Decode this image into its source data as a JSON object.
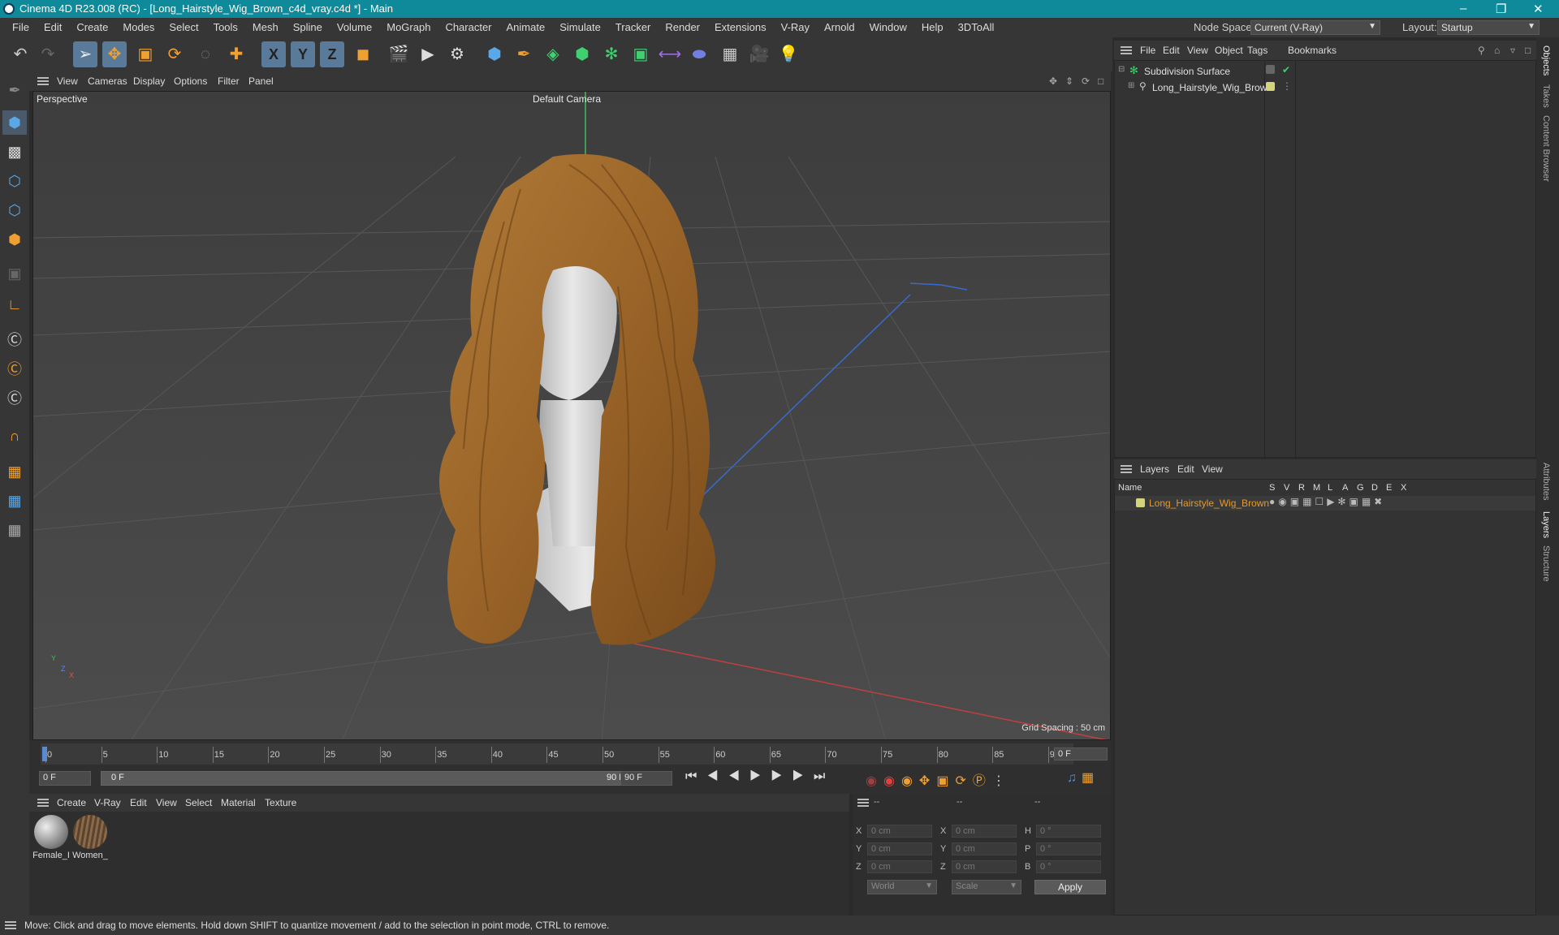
{
  "window": {
    "title": "Cinema 4D R23.008 (RC) - [Long_Hairstyle_Wig_Brown_c4d_vray.c4d *] - Main",
    "controls": [
      "–",
      "❐",
      "✕"
    ]
  },
  "menubar": {
    "items": [
      "File",
      "Edit",
      "Create",
      "Modes",
      "Select",
      "Tools",
      "Mesh",
      "Spline",
      "Volume",
      "MoGraph",
      "Character",
      "Animate",
      "Simulate",
      "Tracker",
      "Render",
      "Extensions",
      "V-Ray",
      "Arnold",
      "Window",
      "Help",
      "3DToAll"
    ],
    "node_space_label": "Node Space:",
    "node_space_value": "Current (V-Ray)",
    "layout_label": "Layout:",
    "layout_value": "Startup"
  },
  "toolbar": {
    "icons": [
      "undo-icon",
      "redo-icon",
      "select-icon",
      "move-icon",
      "scale-icon",
      "rotate-icon",
      "recent-tool-icon",
      "add-icon",
      "x-axis-icon",
      "y-axis-icon",
      "z-axis-icon",
      "coordinate-system-icon",
      "render-region-icon",
      "render-view-icon",
      "render-settings-icon",
      "cube-icon",
      "pen-icon",
      "subdivision-icon",
      "extrude-icon",
      "cloner-icon",
      "array-icon",
      "symmetry-icon",
      "deformer-icon",
      "floor-icon",
      "camera-icon",
      "light-icon"
    ],
    "axis_labels": [
      "X",
      "Y",
      "Z"
    ]
  },
  "viewport": {
    "menu": [
      "View",
      "Cameras",
      "Display",
      "Options",
      "Filter",
      "Panel"
    ],
    "view_name": "Perspective",
    "camera": "Default Camera",
    "grid_spacing": "Grid Spacing : 50 cm",
    "axis_y": "Y",
    "axis_z": "Z",
    "axis_x": "X"
  },
  "timeline": {
    "ticks": [
      "0",
      "5",
      "10",
      "15",
      "20",
      "25",
      "30",
      "35",
      "40",
      "45",
      "50",
      "55",
      "60",
      "65",
      "70",
      "75",
      "80",
      "85",
      "90"
    ],
    "current_frame_right": "0 F",
    "start_field": "0 F",
    "range_start": "0 F",
    "range_end": "90 F",
    "end_field": "90 F"
  },
  "materials": {
    "menu": [
      "Create",
      "V-Ray",
      "Edit",
      "View",
      "Select",
      "Material",
      "Texture"
    ],
    "items": [
      {
        "name": "Female_I",
        "color": "#9a9a9a"
      },
      {
        "name": "Women_",
        "color": "#7a6a58"
      }
    ]
  },
  "coordinates": {
    "headers": [
      "--",
      "--",
      "--"
    ],
    "rows": [
      {
        "a": "X",
        "av": "0 cm",
        "b": "X",
        "bv": "0 cm",
        "c": "H",
        "cv": "0 °"
      },
      {
        "a": "Y",
        "av": "0 cm",
        "b": "Y",
        "bv": "0 cm",
        "c": "P",
        "cv": "0 °"
      },
      {
        "a": "Z",
        "av": "0 cm",
        "b": "Z",
        "bv": "0 cm",
        "c": "B",
        "cv": "0 °"
      }
    ],
    "world": "World",
    "scale": "Scale",
    "apply": "Apply"
  },
  "objects": {
    "menu": [
      "File",
      "Edit",
      "View",
      "Object",
      "Tags",
      "Bookmarks"
    ],
    "tree": [
      {
        "name": "Subdivision Surface",
        "icon": "subdivision-icon"
      },
      {
        "name": "Long_Hairstyle_Wig_Brown",
        "icon": "null-icon"
      }
    ]
  },
  "layers": {
    "menu": [
      "Layers",
      "Edit",
      "View"
    ],
    "columns": [
      "Name",
      "S",
      "V",
      "R",
      "M",
      "L",
      "A",
      "G",
      "D",
      "E",
      "X"
    ],
    "rows": [
      {
        "name": "Long_Hairstyle_Wig_Brown",
        "color": "#d4d47a"
      }
    ]
  },
  "sidetabs": [
    "Objects",
    "Takes",
    "Content Browser",
    "Attributes",
    "Layers",
    "Structure"
  ],
  "status": "Move: Click and drag to move elements. Hold down SHIFT to quantize movement / add to the selection in point mode, CTRL to remove.",
  "colors": {
    "accent": "#0e8a9a",
    "hair": "#a0692a",
    "layer_text": "#e59a2b",
    "highlight": "#5a7a9a"
  }
}
